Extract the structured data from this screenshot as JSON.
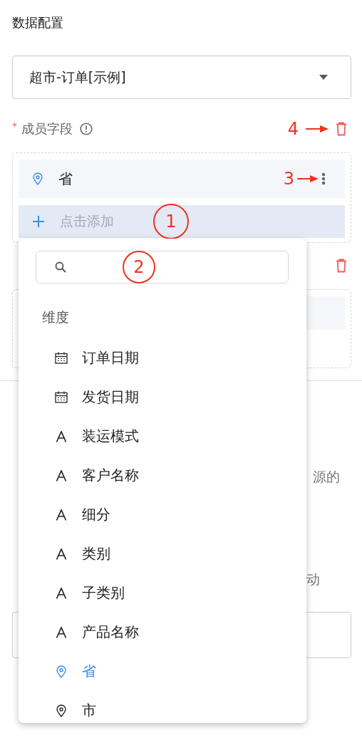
{
  "title": "数据配置",
  "dataset": {
    "value": "超市-订单[示例]"
  },
  "member_field": {
    "label": "成员字段",
    "required_mark": "*",
    "fields": [
      {
        "name": "省",
        "kind": "geo"
      }
    ],
    "add_label": "点击添加"
  },
  "background_fragments": [
    "源的",
    "动"
  ],
  "dropdown": {
    "group": "维度",
    "items": [
      {
        "name": "订单日期",
        "kind": "date",
        "selected": false
      },
      {
        "name": "发货日期",
        "kind": "date",
        "selected": false
      },
      {
        "name": "装运模式",
        "kind": "text",
        "selected": false
      },
      {
        "name": "客户名称",
        "kind": "text",
        "selected": false
      },
      {
        "name": "细分",
        "kind": "text",
        "selected": false
      },
      {
        "name": "类别",
        "kind": "text",
        "selected": false
      },
      {
        "name": "子类别",
        "kind": "text",
        "selected": false
      },
      {
        "name": "产品名称",
        "kind": "text",
        "selected": false
      },
      {
        "name": "省",
        "kind": "geo",
        "selected": true
      },
      {
        "name": "市",
        "kind": "geo",
        "selected": false
      }
    ]
  },
  "annotations": {
    "add_row": "1",
    "search": "2",
    "more": "3",
    "delete": "4"
  }
}
